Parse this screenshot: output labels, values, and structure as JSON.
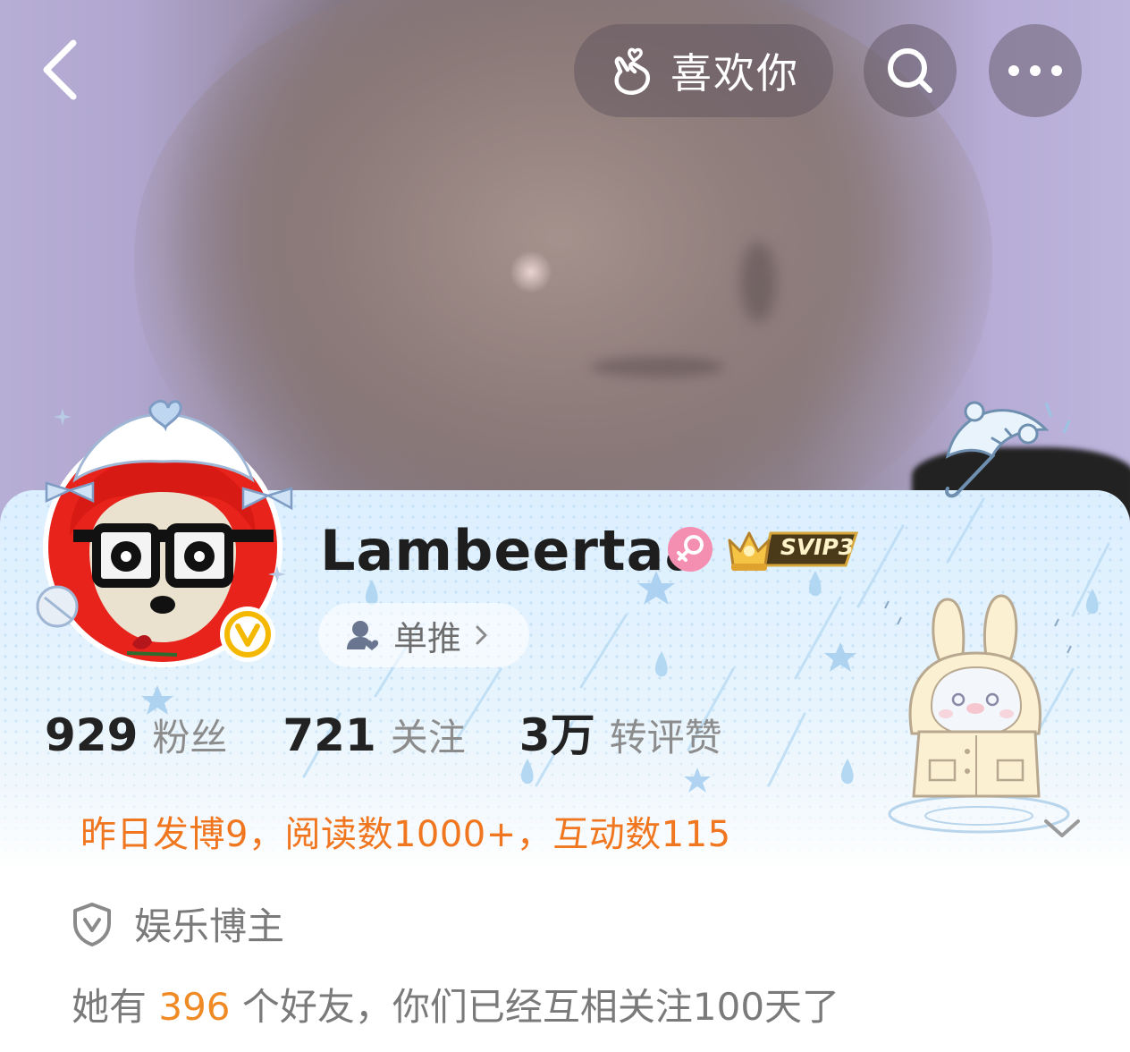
{
  "topbar": {
    "like_label": "喜欢你"
  },
  "profile": {
    "name": "Lambeertaa",
    "svip_label": "SVIP3",
    "tag_label": "单推",
    "stats": [
      {
        "num": "929",
        "label": "粉丝"
      },
      {
        "num": "721",
        "label": "关注"
      },
      {
        "num": "3万",
        "label": "转评赞"
      }
    ],
    "activity": "昨日发博9，阅读数1000+，互动数115",
    "certification": "娱乐博主",
    "friends": {
      "prefix": "她有 ",
      "count": "396",
      "suffix": " 个好友，你们已经互相关注100天了"
    }
  },
  "colors": {
    "accent_orange": "#f0761f",
    "friend_count": "#f08a24",
    "gender_pink": "#f48fb1",
    "verify_gold": "#f5b800"
  }
}
